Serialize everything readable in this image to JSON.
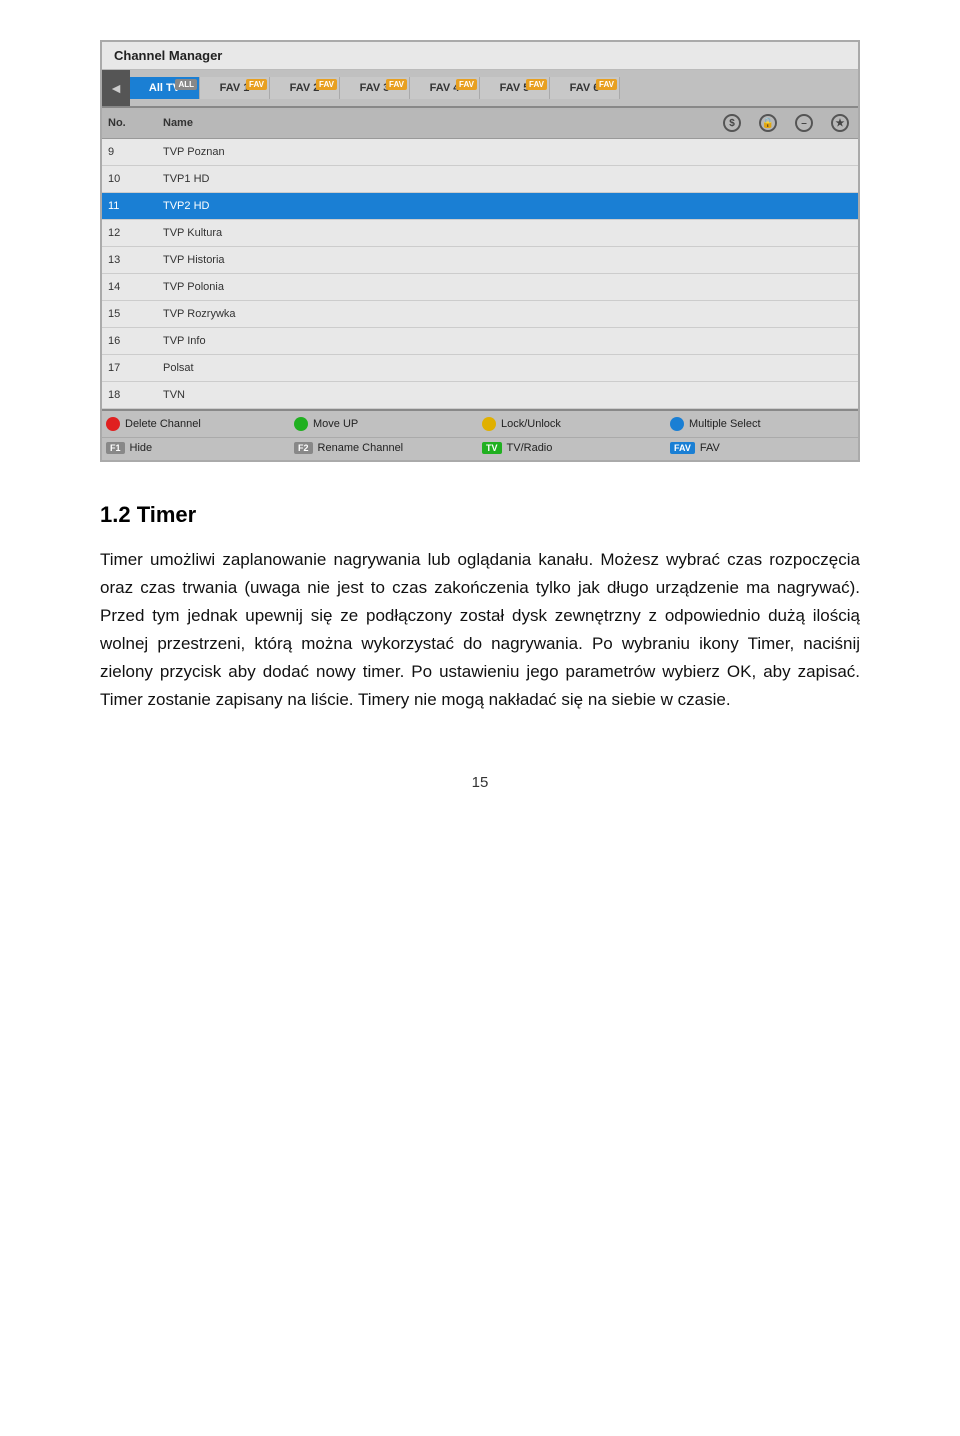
{
  "channelManager": {
    "title": "Channel Manager",
    "arrowIcon": "◄",
    "tabs": [
      {
        "label": "All TV",
        "badge": "ALL",
        "badgeType": "all",
        "active": true
      },
      {
        "label": "FAV 1",
        "badge": "FAV",
        "badgeType": "fav",
        "active": false
      },
      {
        "label": "FAV 2",
        "badge": "FAV",
        "badgeType": "fav",
        "active": false
      },
      {
        "label": "FAV 3",
        "badge": "FAV",
        "badgeType": "fav",
        "active": false
      },
      {
        "label": "FAV 4",
        "badge": "FAV",
        "badgeType": "fav",
        "active": false
      },
      {
        "label": "FAV 5",
        "badge": "FAV",
        "badgeType": "fav",
        "active": false
      },
      {
        "label": "FAV 6",
        "badge": "FAV",
        "badgeType": "fav",
        "active": false
      }
    ],
    "tableHeaders": [
      "No.",
      "Name",
      "S",
      "L",
      "–",
      "★"
    ],
    "rows": [
      {
        "no": "9",
        "name": "TVP Poznan",
        "highlighted": false
      },
      {
        "no": "10",
        "name": "TVP1 HD",
        "highlighted": false
      },
      {
        "no": "11",
        "name": "TVP2 HD",
        "highlighted": true
      },
      {
        "no": "12",
        "name": "TVP Kultura",
        "highlighted": false
      },
      {
        "no": "13",
        "name": "TVP Historia",
        "highlighted": false
      },
      {
        "no": "14",
        "name": "TVP Polonia",
        "highlighted": false
      },
      {
        "no": "15",
        "name": "TVP Rozrywka",
        "highlighted": false
      },
      {
        "no": "16",
        "name": "TVP Info",
        "highlighted": false
      },
      {
        "no": "17",
        "name": "Polsat",
        "highlighted": false
      },
      {
        "no": "18",
        "name": "TVN",
        "highlighted": false
      }
    ],
    "buttonsRow1": [
      {
        "color": "red",
        "label": "Delete Channel"
      },
      {
        "color": "green",
        "label": "Move UP"
      },
      {
        "color": "yellow",
        "label": "Lock/Unlock"
      },
      {
        "color": "blue",
        "label": "Multiple Select"
      }
    ],
    "buttonsRow2": [
      {
        "tag": "F1",
        "tagType": "normal",
        "label": "Hide"
      },
      {
        "tag": "F2",
        "tagType": "normal",
        "label": "Rename Channel"
      },
      {
        "tag": "TV",
        "tagType": "normal",
        "label": "TV/Radio"
      },
      {
        "tag": "FAV",
        "tagType": "blue",
        "label": "FAV"
      }
    ]
  },
  "section": {
    "heading": "1.2 Timer",
    "paragraphs": [
      "Timer umożliwi zaplanowanie nagrywania lub oglądania kanału. Możesz wybrać czas rozpoczęcia oraz czas trwania (uwaga nie jest to czas zakończenia tylko jak długo urządzenie ma nagrywać). Przed tym jednak upewnij się ze podłączony został dysk zewnętrzny z odpowiednio dużą ilością wolnej przestrzeni, którą można wykorzystać do nagrywania. Po wybraniu ikony Timer, naciśnij zielony przycisk aby dodać nowy timer. Po ustawieniu jego parametrów wybierz OK, aby zapisać. Timer zostanie zapisany na liście. Timery nie mogą nakładać się na siebie w czasie."
    ]
  },
  "footer": {
    "pageNumber": "15"
  }
}
